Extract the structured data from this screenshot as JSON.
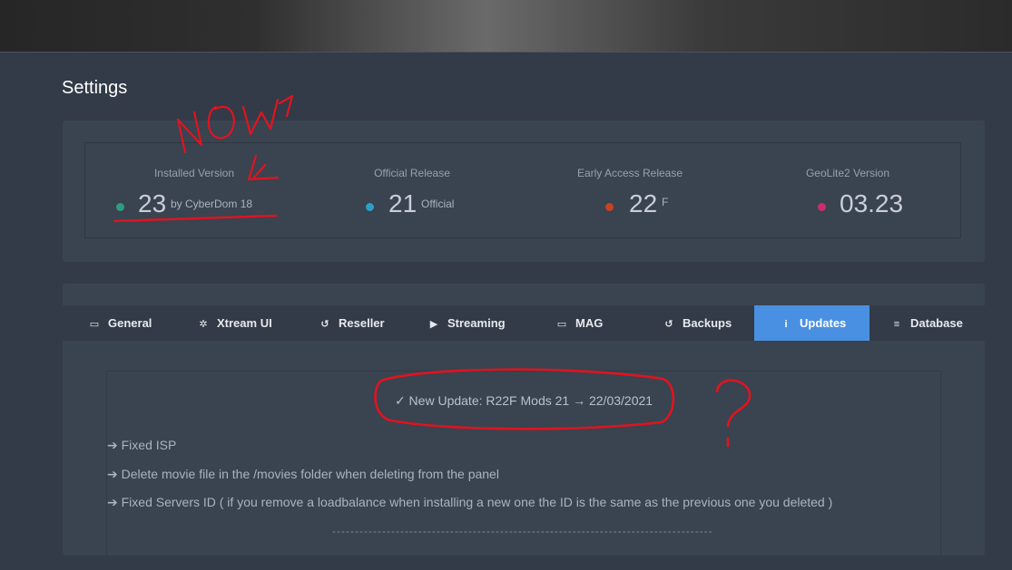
{
  "header": {
    "page_title": "Settings"
  },
  "stats": [
    {
      "label": "Installed Version",
      "value": "23",
      "suffix": "by CyberDom 18",
      "dot_color": "#2f9c7f"
    },
    {
      "label": "Official Release",
      "value": "21",
      "suffix": "Official",
      "dot_color": "#2aa0c8"
    },
    {
      "label": "Early Access Release",
      "value": "22",
      "suffix": "F",
      "dot_color": "#c9421f"
    },
    {
      "label": "GeoLite2 Version",
      "value": "03.23",
      "suffix": "",
      "dot_color": "#cc2e6a"
    }
  ],
  "tabs": [
    {
      "label": "General",
      "icon": "id-card-icon",
      "active": false
    },
    {
      "label": "Xtream UI",
      "icon": "gear-icon",
      "active": false
    },
    {
      "label": "Reseller",
      "icon": "reseller-icon",
      "active": false
    },
    {
      "label": "Streaming",
      "icon": "play-icon",
      "active": false
    },
    {
      "label": "MAG",
      "icon": "tv-icon",
      "active": false
    },
    {
      "label": "Backups",
      "icon": "history-icon",
      "active": false
    },
    {
      "label": "Updates",
      "icon": "info-icon",
      "active": true
    },
    {
      "label": "Database",
      "icon": "database-icon",
      "active": false
    }
  ],
  "updates": {
    "title": "✓ New Update: R22F Mods 21 → 22/03/2021",
    "changes": [
      "➔ Fixed ISP",
      "➔ Delete movie file in the /movies folder when deleting from the panel",
      "➔ Fixed Servers ID ( if you remove a loadbalance when installing a new one the ID is the same as the previous one you deleted )"
    ],
    "separator": "----------------------------------------------------------------------------------------------------"
  },
  "colors": {
    "accent": "#4a90e2",
    "background": "#323b47",
    "panel": "#3a4350",
    "annotation": "#e0141e"
  },
  "annotations": {
    "handwritten_text": "NOW",
    "question_mark": "?"
  }
}
